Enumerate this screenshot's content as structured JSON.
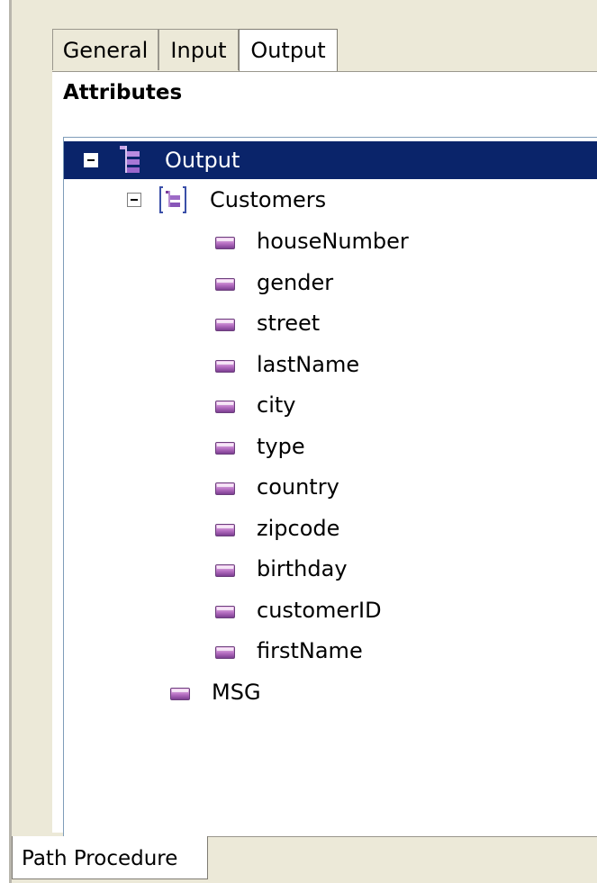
{
  "tabs": [
    {
      "label": "General",
      "active": false
    },
    {
      "label": "Input",
      "active": false
    },
    {
      "label": "Output",
      "active": true
    }
  ],
  "section_title": "Attributes",
  "tree": {
    "root": {
      "label": "Output",
      "icon": "tree-root-icon",
      "selected": true,
      "expanded": true
    },
    "customers": {
      "label": "Customers",
      "icon": "node-group-icon",
      "expanded": true
    },
    "fields": [
      "houseNumber",
      "gender",
      "street",
      "lastName",
      "city",
      "type",
      "country",
      "zipcode",
      "birthday",
      "customerID",
      "firstName"
    ],
    "msg": {
      "label": "MSG",
      "icon": "attribute-icon"
    }
  },
  "bottom_tab": {
    "label": "Path Procedure"
  },
  "colors": {
    "selection": "#0a246a",
    "panel": "#ece9d8",
    "attribute_icon": "#b66fc2"
  }
}
